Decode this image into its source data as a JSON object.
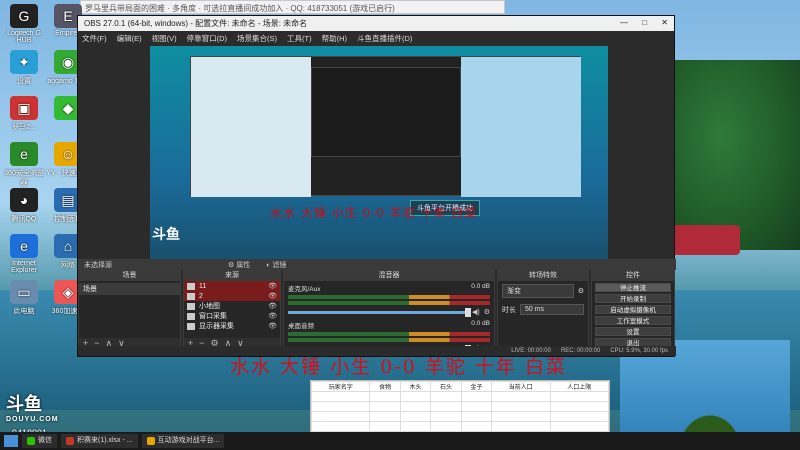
{
  "browser_tab": {
    "title": "罗马里兵带局面的困难 · 多角度 · 可选拉直播间成功加入 · QQ:  418733051 (游戏已启行)"
  },
  "desktop_icons": [
    {
      "label": "Logitech G HUB",
      "glyph": "G",
      "color": "#222"
    },
    {
      "label": "Empires",
      "glyph": "E",
      "color": "#556"
    },
    {
      "label": "设置",
      "glyph": "✦",
      "color": "#2a9fd6"
    },
    {
      "label": "aggamo 帐号",
      "glyph": "◉",
      "color": "#3a3"
    },
    {
      "label": "罗马2...",
      "glyph": "▣",
      "color": "#c33"
    },
    {
      "label": "",
      "glyph": "◆",
      "color": "#3b3"
    },
    {
      "label": "360安全浏览器",
      "glyph": "e",
      "color": "#2a8a2a"
    },
    {
      "label": "YY - 快速登录",
      "glyph": "☺",
      "color": "#e6a700"
    },
    {
      "label": "腾讯QQ",
      "glyph": "◕",
      "color": "#222"
    },
    {
      "label": "控制面板",
      "glyph": "▤",
      "color": "#2b6cb0"
    },
    {
      "label": "Internet Explorer",
      "glyph": "e",
      "color": "#1e6fd9"
    },
    {
      "label": "网络",
      "glyph": "⌂",
      "color": "#2b6cb0"
    },
    {
      "label": "此电脑",
      "glyph": "▭",
      "color": "#6a8cae"
    },
    {
      "label": "360加速器",
      "glyph": "◈",
      "color": "#e55"
    }
  ],
  "obs": {
    "title": "OBS 27.0.1 (64-bit, windows) - 配置文件: 未命名 - 场景: 未命名",
    "window_controls": [
      "—",
      "□",
      "✕"
    ],
    "menu": [
      "文件(F)",
      "编辑(E)",
      "视图(V)",
      "停靠窗口(D)",
      "场景集合(S)",
      "工具(T)",
      "帮助(H)",
      "斗鱼直播插件(D)"
    ],
    "preview": {
      "overlay_text": "水水 大锤 小生 0-0 羊驼 十年 白菜",
      "ticker": "斗鱼平台开播成功",
      "logo": "斗鱼"
    },
    "scene_bar": {
      "label": "未选择源",
      "props_button": "⚙ 属性",
      "filters_button": "◐ 滤镜"
    },
    "scenes": {
      "header": "场景",
      "items": [
        "场景"
      ]
    },
    "sources": {
      "header": "来源",
      "items": [
        {
          "name": "11",
          "icon": "text"
        },
        {
          "name": "2",
          "icon": "text"
        },
        {
          "name": "小地图",
          "icon": "image"
        },
        {
          "name": "窗口采集",
          "icon": "window"
        },
        {
          "name": "显示器采集",
          "icon": "display"
        }
      ]
    },
    "mixer": {
      "header": "混音器",
      "channels": [
        {
          "name": "麦克风/Aux",
          "db": "0.0 dB",
          "level": 0.8
        },
        {
          "name": "桌面音频",
          "db": "0.0 dB",
          "level": 0.8
        }
      ]
    },
    "transitions": {
      "header": "转场特效",
      "type": "渐变",
      "duration_label": "时长",
      "duration": "50 ms"
    },
    "controls": {
      "header": "控件",
      "buttons": [
        "停止推流",
        "开始录制",
        "启动虚拟摄像机",
        "工作室模式",
        "设置",
        "退出"
      ]
    },
    "status": {
      "live": "LIVE: 00:00:00",
      "rec": "REC: 00:00:00",
      "cpu": "CPU: 5.9%, 30.00 fps"
    }
  },
  "desktop_overlay_text": "水水 大锤 小生 0-0 羊驼 十年 白菜",
  "spreadsheet": {
    "headers": [
      "玩家名字",
      "食物",
      "木头",
      "石头",
      "金子",
      "当前人口",
      "人口上限"
    ]
  },
  "douyu": {
    "logo": "斗鱼",
    "sub": "DOUYU.COM",
    "room_id": "9418991"
  },
  "taskbar": [
    {
      "label": "微信",
      "color": "#2dc100"
    },
    {
      "label": "积赛来(1).xlsx - ...",
      "color": "#c0392b"
    },
    {
      "label": "互动游戏对战平台...",
      "color": "#e6a700"
    }
  ]
}
